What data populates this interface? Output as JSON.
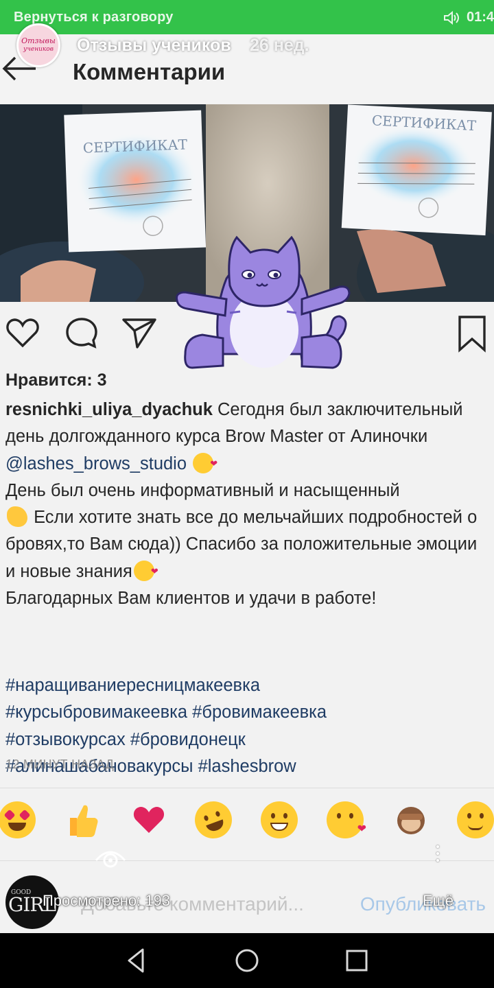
{
  "call_bar": {
    "back_text": "Вернуться к разговору",
    "time": "01:4"
  },
  "story": {
    "avatar_line1": "Отзывы",
    "avatar_line2": "учеников",
    "name": "Отзывы учеников",
    "age": "26 нед."
  },
  "header": {
    "title": "Комментарии"
  },
  "post": {
    "likes": "Нравится: 3",
    "username": "resnichki_uliya_dyachuk",
    "caption_part1": " Сегодня был заключительный день долгожданного курса Brow Master от Алиночки ",
    "mention": "@lashes_brows_studio",
    "caption_part2": "День был очень информативный и насыщенный",
    "caption_part3": " Если хотите знать все до мельчайших подробностей о бровях,то Вам сюда)) Спасибо за положительные эмоции и новые знания",
    "caption_part4": "Благодарных Вам клиентов и удачи в работе!",
    "hashtags": [
      "#наращиваниересницмакеевка",
      "#курсыбровимакеевка",
      "#бровимакеевка",
      "#отзывокурсах",
      "#бровидонецк",
      "#алинашабановакурсы",
      "#lashesbrow"
    ],
    "timestamp": "12 МИНУТ НАЗАД"
  },
  "photo": {
    "cert_left_title": "СЕРТИФИКАТ",
    "cert_right_title": "СЕРТИФИКАТ"
  },
  "reactions": [
    "heart-eyes",
    "thumbs-up",
    "heart",
    "laughing",
    "grinning",
    "kiss",
    "see-no-evil-monkey",
    "smile"
  ],
  "comment_row": {
    "avatar_top": "GOOD",
    "avatar_bottom": "GIRL",
    "placeholder": "Добавьте комментарий...",
    "publish_label": "Опубликовать",
    "views": "Просмотрено: 193",
    "more": "Ещё"
  },
  "colors": {
    "call_bar": "#33c24a",
    "link": "#1f3c64",
    "heart": "#e0245e",
    "cat": "#9b86e0"
  }
}
